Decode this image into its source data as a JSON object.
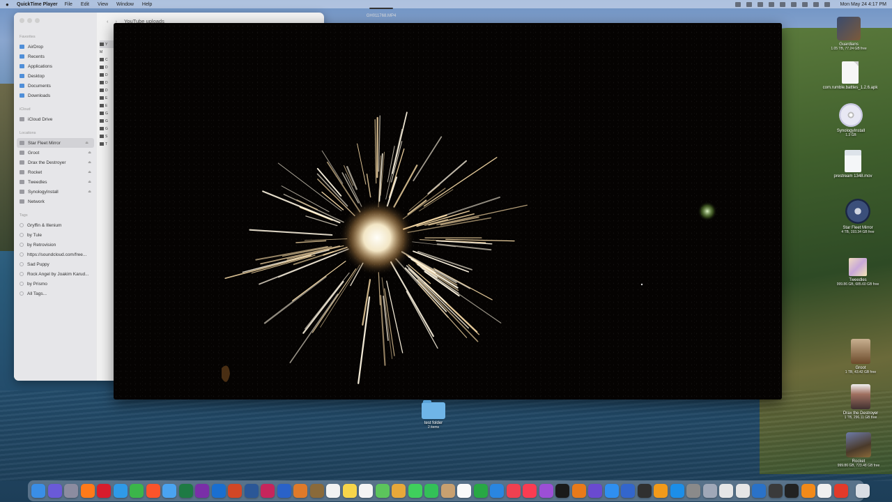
{
  "menubar": {
    "app_name": "QuickTime Player",
    "menus": [
      "File",
      "Edit",
      "View",
      "Window",
      "Help"
    ],
    "clock": "Mon May 24  4:17 PM"
  },
  "finder": {
    "path_title": "YouTube uploads",
    "sections": {
      "favorites": "Favorites",
      "icloud": "iCloud",
      "locations": "Locations",
      "tags": "Tags"
    },
    "favorites": [
      "AirDrop",
      "Recents",
      "Applications",
      "Desktop",
      "Documents",
      "Downloads"
    ],
    "icloud": [
      "iCloud Drive"
    ],
    "locations": [
      "Star Fleet Mirror",
      "Groot",
      "Drax the Destroyer",
      "Rocket",
      "Tweedles",
      "SynologyInstall",
      "Network"
    ],
    "tags": [
      "Gryffin & Illenium",
      "by Tule",
      "by Retrovision",
      "https://soundcloud.com/free...",
      "Sad Puppy",
      "Rock Angel by Joakim Karud...",
      "by Prismo",
      "All Tags..."
    ],
    "file_initials": [
      "Y",
      "M",
      "C",
      "D",
      "D",
      "D",
      "D",
      "E",
      "E",
      "G",
      "G",
      "G",
      "S",
      "T"
    ]
  },
  "player": {
    "title": "GH011768.MP4"
  },
  "desktop": {
    "icons": [
      {
        "name": "Guardians",
        "sub": "1.05 TB, 77.24 GB free"
      },
      {
        "name": "com.rumble.battles_1.2.6.apk",
        "sub": ""
      },
      {
        "name": "SynologyInstall",
        "sub": "1.3 GB"
      },
      {
        "name": "prestream 1348.mov",
        "sub": ""
      },
      {
        "name": "Star Fleet Mirror",
        "sub": "4 TB, 193.34 GB free"
      },
      {
        "name": "Tweedles",
        "sub": "999.86 GB, 685.60 GB free"
      },
      {
        "name": "Groot",
        "sub": "1 TB, 43.42 GB free"
      },
      {
        "name": "Drax the Destroyer",
        "sub": "1 TB, 296.11 GB free"
      },
      {
        "name": "Rocket",
        "sub": "999.86 GB, 723.48 GB free"
      },
      {
        "name": "test folder",
        "sub": "2 items"
      }
    ]
  },
  "dock": {
    "apps": [
      {
        "name": "finder",
        "color": "#3a8ee6"
      },
      {
        "name": "siri",
        "color": "#6a5ad8"
      },
      {
        "name": "launchpad",
        "color": "#8c8ca0"
      },
      {
        "name": "firefox",
        "color": "#ff7a1a"
      },
      {
        "name": "opera",
        "color": "#d81c2c"
      },
      {
        "name": "safari",
        "color": "#2f9ae8"
      },
      {
        "name": "chrome",
        "color": "#3bb54a"
      },
      {
        "name": "brave",
        "color": "#fb542b"
      },
      {
        "name": "mail",
        "color": "#4aa3f0"
      },
      {
        "name": "excel",
        "color": "#1e7a44"
      },
      {
        "name": "onenote",
        "color": "#7a2fa8"
      },
      {
        "name": "outlook",
        "color": "#1a6fd0"
      },
      {
        "name": "powerpoint",
        "color": "#d24726"
      },
      {
        "name": "word",
        "color": "#2b5797"
      },
      {
        "name": "indesign",
        "color": "#c6255c"
      },
      {
        "name": "blocker",
        "color": "#2a62c8"
      },
      {
        "name": "noentry",
        "color": "#e07a2a"
      },
      {
        "name": "utility",
        "color": "#8a6a3a"
      },
      {
        "name": "calendar",
        "color": "#f2f2f2"
      },
      {
        "name": "notes",
        "color": "#f7d54a"
      },
      {
        "name": "reminders",
        "color": "#f4f4f4"
      },
      {
        "name": "maps",
        "color": "#5cc45c"
      },
      {
        "name": "photos",
        "color": "#e8a83a"
      },
      {
        "name": "messages",
        "color": "#3fcf5c"
      },
      {
        "name": "facetime",
        "color": "#33c058"
      },
      {
        "name": "contacts",
        "color": "#c8a070"
      },
      {
        "name": "textedit",
        "color": "#fafafa"
      },
      {
        "name": "numbers",
        "color": "#28a844"
      },
      {
        "name": "keynote",
        "color": "#2a86e0"
      },
      {
        "name": "news",
        "color": "#f04050"
      },
      {
        "name": "music",
        "color": "#fa3c52"
      },
      {
        "name": "podcasts",
        "color": "#9c4fd6"
      },
      {
        "name": "tv",
        "color": "#1a1a1a"
      },
      {
        "name": "garageband",
        "color": "#e87a1a"
      },
      {
        "name": "imovie",
        "color": "#6a4ad0"
      },
      {
        "name": "app-store",
        "color": "#2f8ff0"
      },
      {
        "name": "vpn",
        "color": "#3366cc"
      },
      {
        "name": "obs",
        "color": "#303030"
      },
      {
        "name": "books",
        "color": "#f29a1a"
      },
      {
        "name": "xcode",
        "color": "#1c8ee8"
      },
      {
        "name": "system-prefs",
        "color": "#8a8a8a"
      },
      {
        "name": "preview",
        "color": "#a0a8b8"
      },
      {
        "name": "silverlock",
        "color": "#e6e6e6"
      },
      {
        "name": "screen-share",
        "color": "#e6e6e6"
      },
      {
        "name": "quicktime",
        "color": "#2a72c8"
      },
      {
        "name": "capture",
        "color": "#3a3a3a"
      },
      {
        "name": "terminal",
        "color": "#222222"
      },
      {
        "name": "vlc",
        "color": "#f28a1a"
      },
      {
        "name": "transmit",
        "color": "#f0f0f0"
      },
      {
        "name": "todo",
        "color": "#e23a2a"
      },
      {
        "name": "trash",
        "color": "#d8dde4"
      }
    ]
  }
}
